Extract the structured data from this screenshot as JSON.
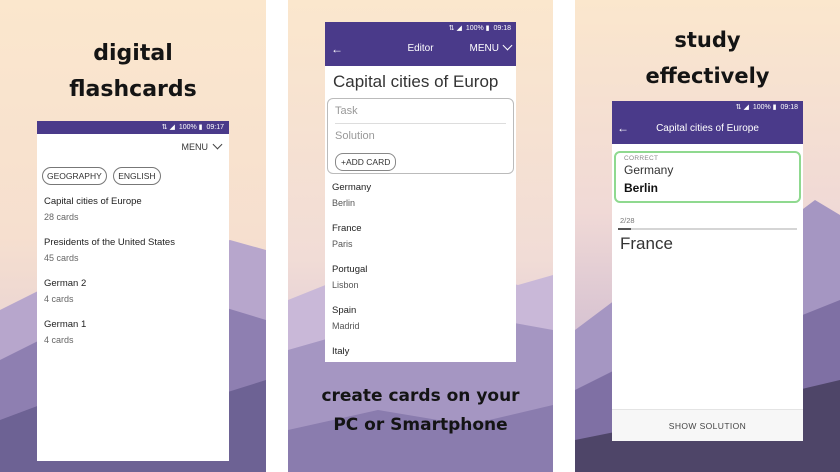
{
  "status": {
    "signal": "⇅ ◢",
    "battery": "100% ▮",
    "time_1": "09:17",
    "time_2": "09:18",
    "time_3": "09:18"
  },
  "panel1": {
    "caption": [
      "digital",
      "flashcards"
    ],
    "menu_label": "MENU",
    "chips": [
      "GEOGRAPHY",
      "ENGLISH"
    ],
    "decks": [
      {
        "title": "Capital cities of Europe",
        "count": "28 cards"
      },
      {
        "title": "Presidents of the United States",
        "count": "45 cards"
      },
      {
        "title": "German 2",
        "count": "4 cards"
      },
      {
        "title": "German 1",
        "count": "4 cards"
      }
    ]
  },
  "panel2": {
    "caption": [
      "create cards on your",
      "PC or Smartphone"
    ],
    "back_arrow": "←",
    "title": "Editor",
    "menu_label": "MENU",
    "set_title": "Capital cities of Europ",
    "task_placeholder": "Task",
    "solution_placeholder": "Solution",
    "add_card_label": "+ADD CARD",
    "cards": [
      {
        "q": "Germany",
        "a": "Berlin"
      },
      {
        "q": "France",
        "a": "Paris"
      },
      {
        "q": "Portugal",
        "a": "Lisbon"
      },
      {
        "q": "Spain",
        "a": "Madrid"
      },
      {
        "q": "Italy",
        "a": ""
      }
    ]
  },
  "panel3": {
    "caption": [
      "study",
      "effectively"
    ],
    "back_arrow": "←",
    "title": "Capital cities of Europe",
    "correct_label": "CORRECT",
    "correct_question": "Germany",
    "correct_answer": "Berlin",
    "progress_text": "2/28",
    "progress_fraction": 0.0714,
    "question": "France",
    "show_solution_label": "SHOW SOLUTION"
  },
  "colors": {
    "accent": "#4a3a8a",
    "correct_border": "#8fd98f",
    "sky_top": "#fbe7cd",
    "mountain": "#9a8bba"
  }
}
